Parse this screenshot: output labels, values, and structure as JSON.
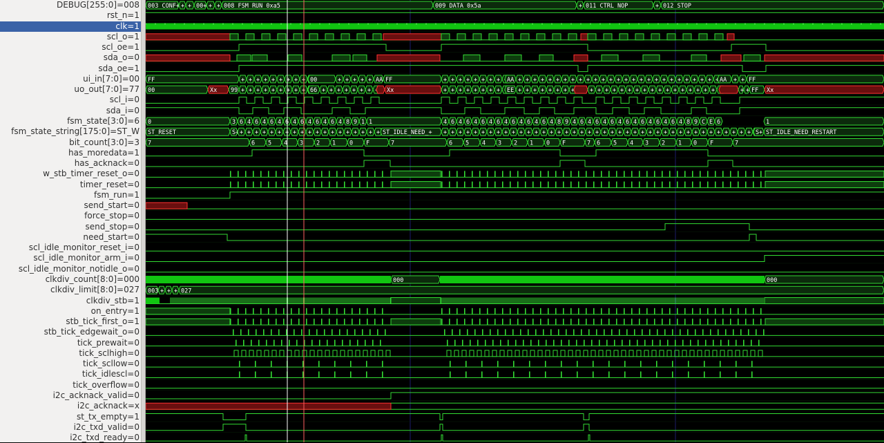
{
  "signals": [
    {
      "name": "DEBUG[255:0]",
      "value": "008"
    },
    {
      "name": "rst_n",
      "value": "1"
    },
    {
      "name": "clk",
      "value": "1",
      "selected": true
    },
    {
      "name": "scl_o",
      "value": "1"
    },
    {
      "name": "scl_oe",
      "value": "1"
    },
    {
      "name": "sda_o",
      "value": "0"
    },
    {
      "name": "sda_oe",
      "value": "1"
    },
    {
      "name": "ui_in[7:0]",
      "value": "00"
    },
    {
      "name": "uo_out[7:0]",
      "value": "77"
    },
    {
      "name": "scl_i",
      "value": "0"
    },
    {
      "name": "sda_i",
      "value": "0"
    },
    {
      "name": "fsm_state[3:0]",
      "value": "6"
    },
    {
      "name": "fsm_state_string[175:0]",
      "value": "ST_W"
    },
    {
      "name": "bit_count[3:0]",
      "value": "3"
    },
    {
      "name": "has_moredata",
      "value": "1"
    },
    {
      "name": "has_acknack",
      "value": "0"
    },
    {
      "name": "w_stb_timer_reset_o",
      "value": "0"
    },
    {
      "name": "timer_reset",
      "value": "0"
    },
    {
      "name": "fsm_run",
      "value": "1"
    },
    {
      "name": "send_start",
      "value": "0"
    },
    {
      "name": "force_stop",
      "value": "0"
    },
    {
      "name": "send_stop",
      "value": "0"
    },
    {
      "name": "need_start",
      "value": "0"
    },
    {
      "name": "scl_idle_monitor_reset_i",
      "value": "0"
    },
    {
      "name": "scl_idle_monitor_arm_i",
      "value": "0"
    },
    {
      "name": "scl_idle_monitor_notidle_o",
      "value": "0"
    },
    {
      "name": "clkdiv_count[8:0]",
      "value": "000"
    },
    {
      "name": "clkdiv_limit[8:0]",
      "value": "027"
    },
    {
      "name": "clkdiv_stb",
      "value": "1"
    },
    {
      "name": "on_entry",
      "value": "1"
    },
    {
      "name": "stb_tick_first_o",
      "value": "1"
    },
    {
      "name": "stb_tick_edgewait_o",
      "value": "0"
    },
    {
      "name": "tick_prewait",
      "value": "0"
    },
    {
      "name": "tick_sclhigh",
      "value": "0"
    },
    {
      "name": "tick_scllow",
      "value": "0"
    },
    {
      "name": "tick_idlescl",
      "value": "0"
    },
    {
      "name": "tick_overflow",
      "value": "0"
    },
    {
      "name": "i2c_acknack_valid",
      "value": "0"
    },
    {
      "name": "i2c_acknack",
      "value": "x"
    },
    {
      "name": "st_tx_empty",
      "value": "1"
    },
    {
      "name": "i2c_txd_valid",
      "value": "0"
    },
    {
      "name": "i2c_txd_ready",
      "value": "0"
    }
  ],
  "colors": {
    "wave": "#33dd33",
    "bus_fill": "#0c2a0c",
    "x_red": "#ff3030",
    "x_fill": "#6a0f0f",
    "cursor_white": "#ffffff",
    "cursor_red": "#ff6060",
    "grid": "#1d1d6a",
    "dense_fill": "#11c511"
  },
  "bus_labels": {
    "debug": [
      "003 CONF+",
      "+",
      "+",
      "00+",
      "+",
      "+",
      "008 FSM RUN 0xa5",
      "009 DATA 0x5a",
      "+",
      "011 CTRL NOP",
      "+",
      "012 STOP"
    ],
    "ui_in": [
      "FF",
      "00",
      "AA",
      "FF",
      "AA",
      "EE",
      "AA",
      "FF"
    ],
    "uo_out": [
      "00",
      "Xx",
      "99",
      "66",
      "Xx",
      "EE",
      "FF",
      "Xx"
    ],
    "fsm_state": [
      "0",
      "3",
      "6",
      "4",
      "8",
      "9",
      "1",
      "C",
      "E",
      "2"
    ],
    "fsm_state_string": [
      "ST_RESET",
      "S+",
      "ST_IDLE_NEED_+",
      "S+",
      "ST_IDLE_NEED_RESTART"
    ],
    "bit_count": [
      "7",
      "6",
      "5",
      "4",
      "3",
      "2",
      "1",
      "0",
      "F"
    ],
    "clkdiv_count": [
      "000"
    ],
    "clkdiv_limit": [
      "003",
      "+",
      "+",
      "+",
      "027"
    ],
    "plus": "+"
  }
}
